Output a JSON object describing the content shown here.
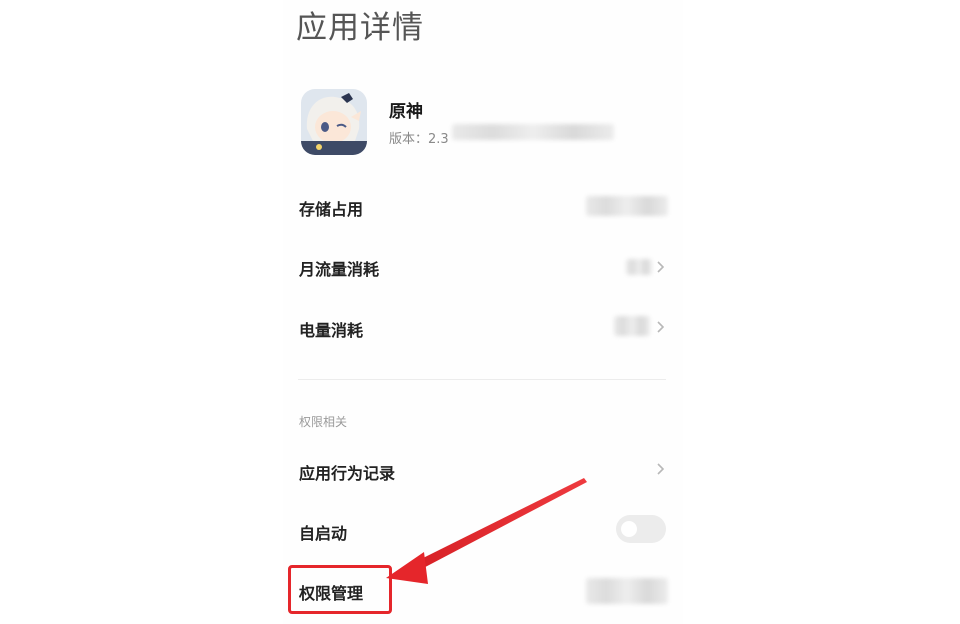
{
  "header": {
    "title": "应用详情"
  },
  "app": {
    "name": "原神",
    "version_label": "版本：2.3"
  },
  "rows": {
    "storage": "存储占用",
    "monthly_data": "月流量消耗",
    "battery": "电量消耗"
  },
  "permissions_section": {
    "label": "权限相关",
    "behavior_log": "应用行为记录",
    "auto_start": "自启动",
    "auto_start_enabled": false,
    "permission_manage": "权限管理"
  },
  "colors": {
    "highlight": "#e5262b",
    "toggle_off": "#ececec"
  },
  "icons": {
    "chevron": "chevron-right-icon",
    "app_icon": "genshin-paimon-app-icon"
  }
}
